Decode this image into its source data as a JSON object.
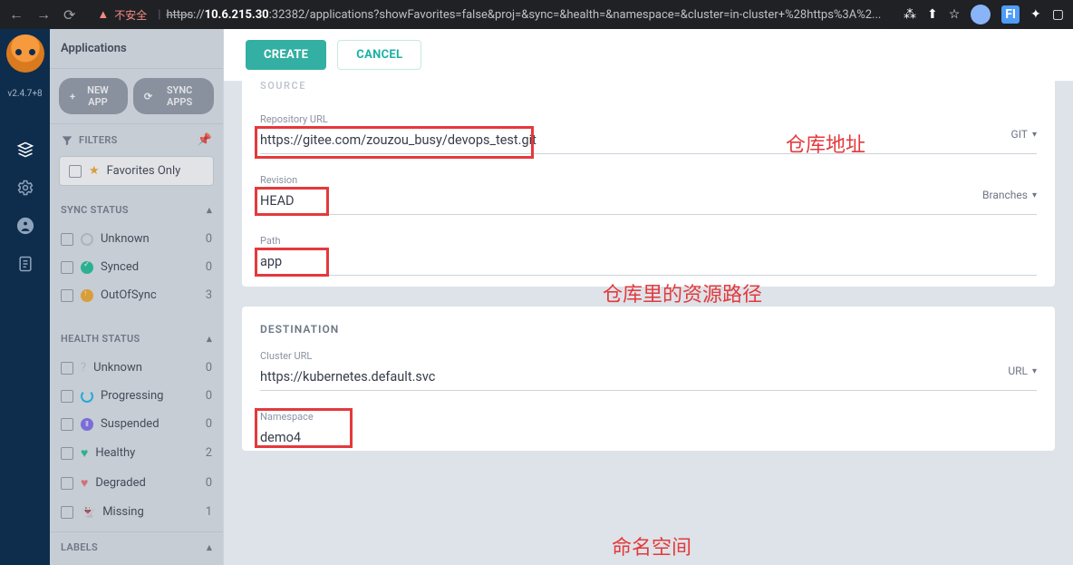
{
  "browser": {
    "insecure_label": "不安全",
    "url_proto": "https",
    "url_host": "10.6.215.30",
    "url_rest": ":32382/applications?showFavorites=false&proj=&sync=&health=&namespace=&cluster=in-cluster+%28https%3A%2..."
  },
  "rail": {
    "version": "v2.4.7+8"
  },
  "sidebar": {
    "title": "Applications",
    "new_app": "NEW APP",
    "sync_apps": "SYNC APPS",
    "filters_label": "FILTERS",
    "favorites_label": "Favorites Only",
    "sync_status_label": "SYNC STATUS",
    "sync_items": [
      {
        "label": "Unknown",
        "count": "0"
      },
      {
        "label": "Synced",
        "count": "0"
      },
      {
        "label": "OutOfSync",
        "count": "3"
      }
    ],
    "health_status_label": "HEALTH STATUS",
    "health_items": [
      {
        "label": "Unknown",
        "count": "0"
      },
      {
        "label": "Progressing",
        "count": "0"
      },
      {
        "label": "Suspended",
        "count": "0"
      },
      {
        "label": "Healthy",
        "count": "2"
      },
      {
        "label": "Degraded",
        "count": "0"
      },
      {
        "label": "Missing",
        "count": "1"
      }
    ],
    "labels_label": "LABELS"
  },
  "topbar": {
    "create": "CREATE",
    "cancel": "CANCEL"
  },
  "source": {
    "heading_partial": "SOURCE",
    "repo_label": "Repository URL",
    "repo_value": "https://gitee.com/zouzou_busy/devops_test.git",
    "repo_type": "GIT",
    "revision_label": "Revision",
    "revision_value": "HEAD",
    "revision_type": "Branches",
    "path_label": "Path",
    "path_value": "app"
  },
  "destination": {
    "heading": "DESTINATION",
    "cluster_label": "Cluster URL",
    "cluster_value": "https://kubernetes.default.svc",
    "cluster_type": "URL",
    "namespace_label": "Namespace",
    "namespace_value": "demo4"
  },
  "annotations": {
    "repo": "仓库地址",
    "path": "仓库里的资源路径",
    "namespace": "命名空间"
  }
}
